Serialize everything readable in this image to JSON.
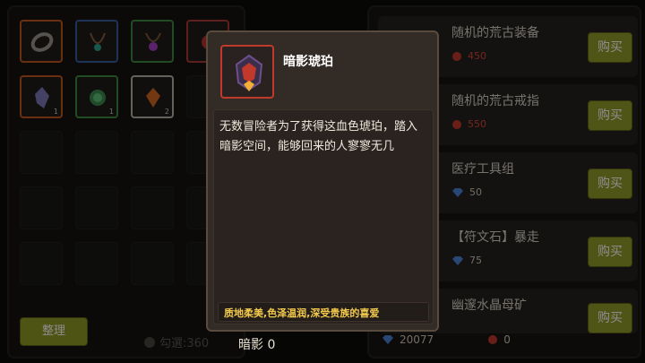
{
  "inventory": {
    "sort_button": "整理",
    "quest_text": "勾選:360",
    "items": [
      {
        "icon": "ring-icon",
        "rarity": "orange",
        "qty": ""
      },
      {
        "icon": "necklace-icon",
        "rarity": "blue",
        "qty": ""
      },
      {
        "icon": "amulet-icon",
        "rarity": "green",
        "qty": ""
      },
      {
        "icon": "gem-icon",
        "rarity": "red",
        "qty": ""
      },
      {
        "icon": "crystal-icon",
        "rarity": "orange",
        "qty": "1"
      },
      {
        "icon": "emerald-icon",
        "rarity": "green",
        "qty": "1"
      },
      {
        "icon": "amber-icon",
        "rarity": "white",
        "qty": "2"
      }
    ]
  },
  "shop": {
    "buy_label": "购买",
    "items": [
      {
        "name": "随机的荒古装备",
        "price": "450",
        "currency": "ruby-icon",
        "price_color": "red"
      },
      {
        "name": "随机的荒古戒指",
        "price": "550",
        "currency": "ruby-icon",
        "price_color": "red"
      },
      {
        "name": "医疗工具组",
        "price": "50",
        "currency": "diamond-icon",
        "price_color": "plain"
      },
      {
        "name": "【符文石】暴走",
        "price": "75",
        "currency": "diamond-icon",
        "price_color": "plain"
      },
      {
        "name": "幽邃水晶母矿",
        "price": "",
        "currency": "",
        "price_color": "plain"
      }
    ],
    "wallet": {
      "diamonds": "20077",
      "rubies": "0"
    }
  },
  "tooltip": {
    "name": "暗影琥珀",
    "description": "无数冒险者为了获得这血色琥珀，踏入暗影空间，能够回来的人寥寥无几",
    "flavor": "质地柔美,色泽温润,深受贵族的喜爱"
  },
  "center_label": "暗影 0"
}
